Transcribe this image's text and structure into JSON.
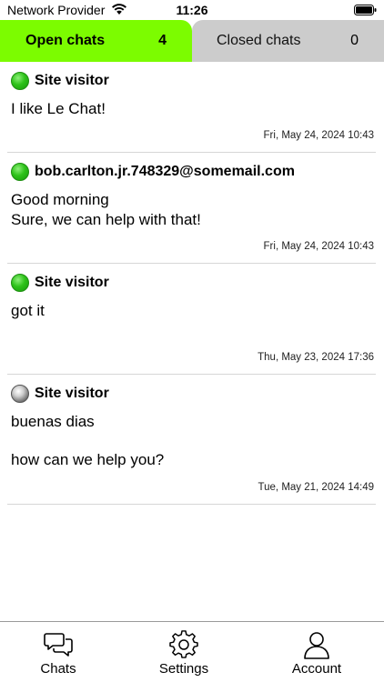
{
  "status_bar": {
    "carrier": "Network Provider",
    "time": "11:26"
  },
  "tabs": [
    {
      "label": "Open chats",
      "count": "4",
      "active": true
    },
    {
      "label": "Closed chats",
      "count": "0",
      "active": false
    }
  ],
  "chats": [
    {
      "name": "Site visitor",
      "online": true,
      "message": "I like Le Chat!",
      "time": "Fri, May 24, 2024 10:43"
    },
    {
      "name": "bob.carlton.jr.748329@somemail.com",
      "online": true,
      "message_lines": [
        "Good morning",
        "Sure, we can help with that!"
      ],
      "time": "Fri, May 24, 2024 10:43"
    },
    {
      "name": "Site visitor",
      "online": true,
      "message": "got it",
      "time": "Thu, May 23, 2024 17:36"
    },
    {
      "name": "Site visitor",
      "online": false,
      "message_lines": [
        "buenas dias",
        "how can we help you?"
      ],
      "time": "Tue, May 21, 2024 14:49"
    }
  ],
  "nav": [
    {
      "label": "Chats",
      "icon": "chats-icon"
    },
    {
      "label": "Settings",
      "icon": "gear-icon"
    },
    {
      "label": "Account",
      "icon": "person-icon"
    }
  ],
  "colors": {
    "active_tab": "#7cfc00",
    "inactive_tab": "#cccccc",
    "online_dot": "#2ec21a",
    "offline_dot": "#7a7a7a"
  }
}
